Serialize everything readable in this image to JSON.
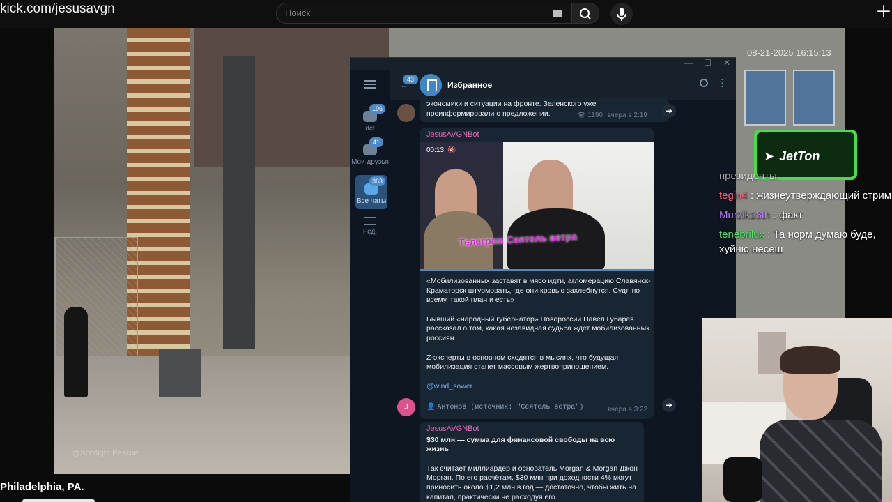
{
  "browser": {
    "url": "kick.com/jesusavgn",
    "search_placeholder": "Поиск"
  },
  "stream": {
    "timestamp": "08-21-2025 16:15:13",
    "watermark": "@Spotlight.Rescue",
    "caption": "Philadelphia, PA."
  },
  "telegram": {
    "rail": [
      {
        "label": "dct",
        "badge": "196"
      },
      {
        "label": "Мои друзья",
        "badge": "41"
      },
      {
        "label": "Все чаты",
        "badge": "363"
      },
      {
        "label": "Ред.",
        "badge": ""
      }
    ],
    "header": {
      "back_badge": "43",
      "title": "Избранное"
    },
    "messages": [
      {
        "text": "экономики и ситуации на фронте. Зеленского уже проинформировали о предложении.",
        "views": "1190",
        "time": "вчера в 2:19"
      },
      {
        "sender": "JesusAVGNBot",
        "video_time": "00:13",
        "video_caption": "Телеграм Сеятель ветра",
        "paragraphs": [
          "«Мобилизованных заставят в мясо идти, агломерацию Славянск-Краматорск штурмовать, где они кровью захлебнутся. Судя по всему, такой план и есть»",
          "Бывший «народный губернатор» Новороссии Павел Губарев рассказал о том, какая незавидная судьба ждет мобилизованных россиян.",
          "Z-эксперты в основном сходятся в мыслях, что будущая мобилизация станет массовым жертвоприношением."
        ],
        "link": "@wind_sower",
        "footer": "Антонов (источник: \"Сеятель ветра\")",
        "time": "вчера в 3:22",
        "avatar_letter": "J"
      },
      {
        "sender": "JesusAVGNBot",
        "headline": "$30 млн — сумма для финансовой свободы на всю жизнь",
        "body": "Так считает миллиардер и основатель Morgan & Morgan Джон Морган. По его расчётам, $30 млн при доходности 4% могут приносить около $1,2 млн в год — достаточно, чтобы жить на капитал, практически не расходуя его."
      }
    ]
  },
  "chat_overlay": {
    "partial_top": "президенты.",
    "lines": [
      {
        "user": "tegin4",
        "text": "жизнеутверждающий стрим",
        "color": "#ff5a7a"
      },
      {
        "user": "Murzik18th",
        "text": "факт",
        "color": "#c07bff"
      },
      {
        "user": "tenebrilux",
        "text": "Та норм думаю буде, хуйню несеш",
        "color": "#56e26b"
      }
    ]
  },
  "sponsor": {
    "label": "JetTon"
  },
  "colors": {
    "accent_blue": "#4a8acb",
    "tg_bg": "#0e1621",
    "sender_pink": "#e569b0",
    "jetton_green": "#43e04a"
  }
}
